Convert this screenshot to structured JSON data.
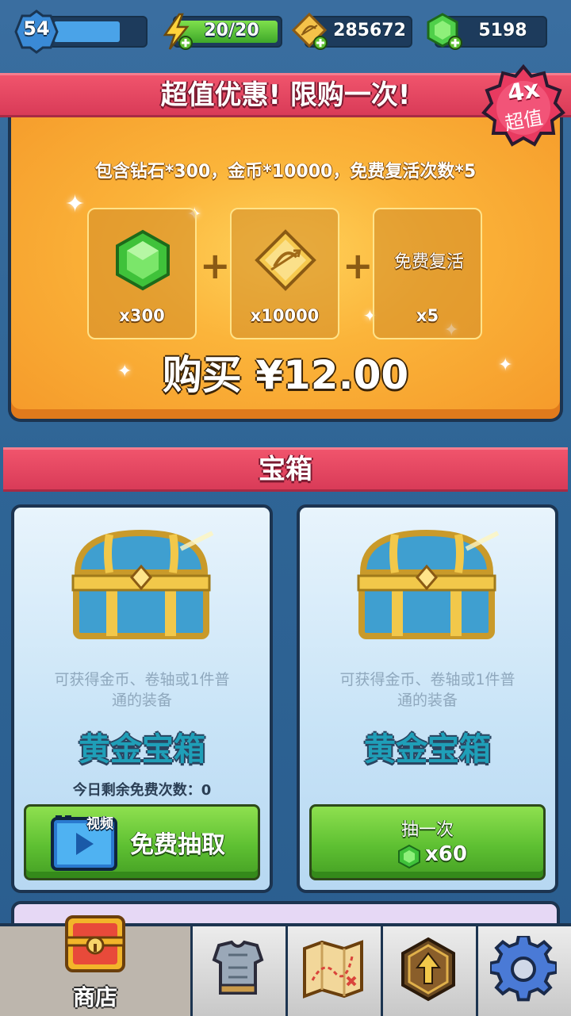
{
  "status": {
    "level": "54",
    "energy": "20/20",
    "gold": "285672",
    "gems": "5198",
    "level_progress": 0.75
  },
  "offer": {
    "title": "超值优惠! 限购一次!",
    "badge_multiplier": "4x",
    "badge_text": "超值",
    "description": "包含钻石*300，金币*10000，免费复活次数*5",
    "rewards": [
      {
        "icon": "gem-icon",
        "amount": "x300"
      },
      {
        "icon": "gold-coin-icon",
        "amount": "x10000"
      },
      {
        "label": "免费复活",
        "amount": "x5"
      }
    ],
    "plus": "+",
    "buy_label": "购买 ¥12.00"
  },
  "chests": {
    "section_title": "宝箱",
    "cards": [
      {
        "description_line1": "可获得金币、卷轴或1件普",
        "description_line2": "通的装备",
        "name": "黄金宝箱",
        "free_count": "今日剩余免费次数：0",
        "video_tag": "视频",
        "button_label": "免费抽取"
      },
      {
        "description_line1": "可获得金币、卷轴或1件普",
        "description_line2": "通的装备",
        "name": "黄金宝箱",
        "button_label": "抽一次",
        "price": "x60"
      }
    ]
  },
  "nav": {
    "active_label": "商店",
    "items": [
      "shop-chest-icon",
      "armor-icon",
      "map-icon",
      "upgrade-icon",
      "gear-icon"
    ]
  },
  "colors": {
    "header_red": "#e34862",
    "offer_orange": "#fbb43a",
    "button_green": "#5ec032",
    "chest_name": "#1f9fb8"
  }
}
